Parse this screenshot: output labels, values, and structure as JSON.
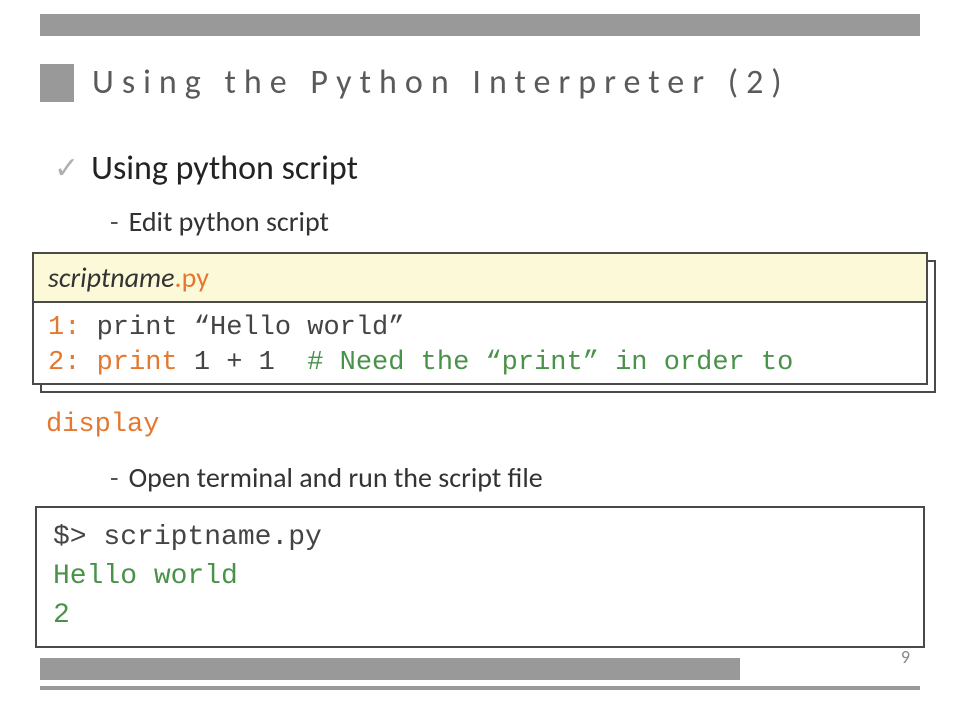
{
  "slide": {
    "title": "Using the Python Interpreter (2)",
    "page_number": "9"
  },
  "bullet_main": "Using python script",
  "bullet_sub1": "Edit python script",
  "bullet_sub2": "Open terminal and run the script file",
  "file": {
    "name_base": "scriptname",
    "name_ext": ".py",
    "line1_num": "1:",
    "line1_code": " print “Hello world”",
    "line2_num": "2:",
    "line2_kw": " print",
    "line2_rest": " 1 + 1  ",
    "line2_comment": "# Need the “print” in order to",
    "overflow": "display"
  },
  "terminal": {
    "cmd": "$> scriptname.py",
    "out1": "Hello world",
    "out2": "2"
  }
}
